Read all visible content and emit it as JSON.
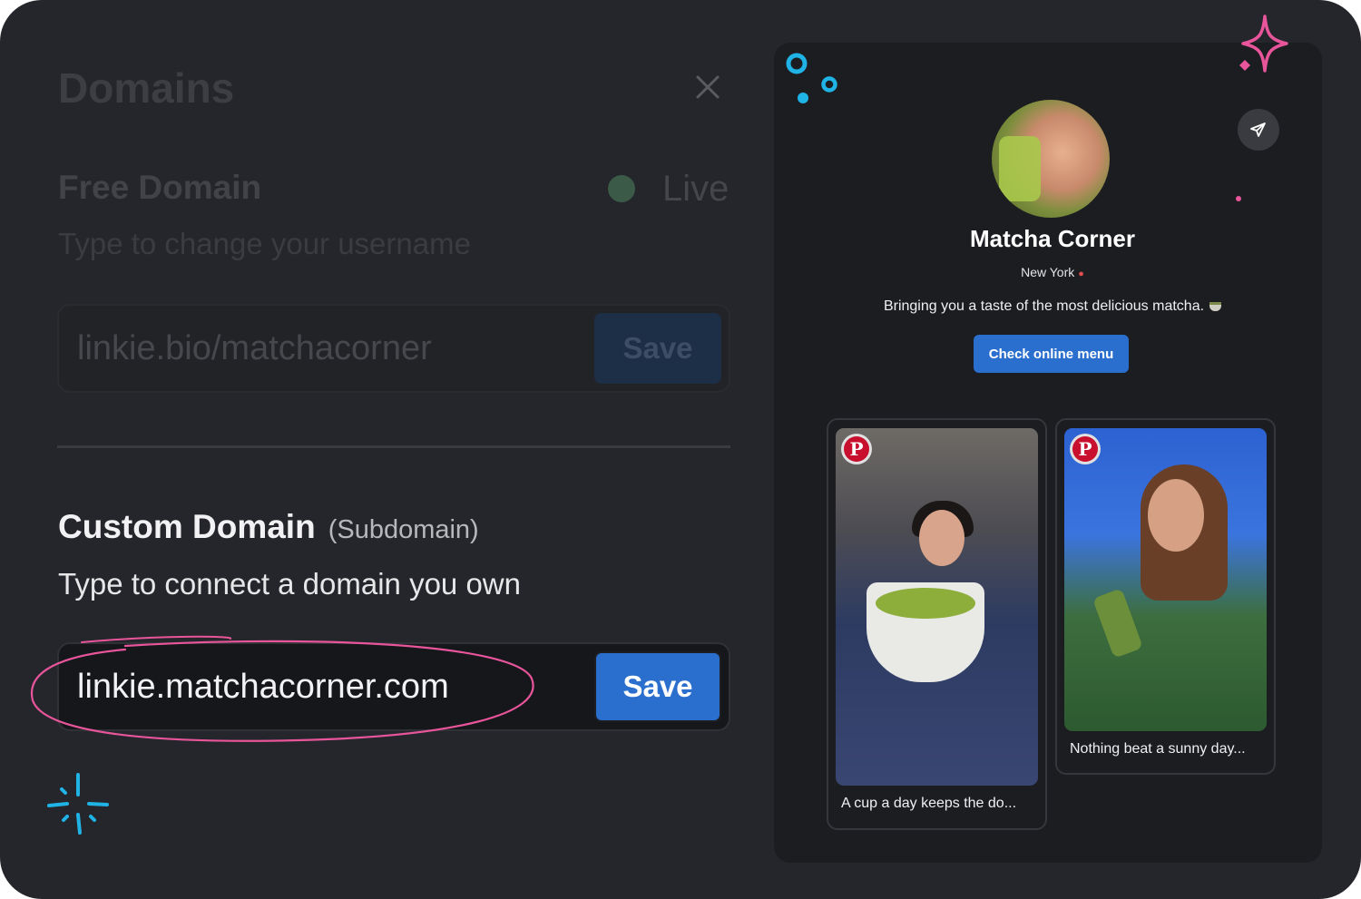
{
  "colors": {
    "background": "#25262b",
    "accent_blue": "#2a6fce",
    "scribble_pink": "#e8559b",
    "deco_cyan": "#1fb3e6",
    "live_green": "#3b5a47"
  },
  "dialog": {
    "title": "Domains",
    "close_icon": "close-icon"
  },
  "free_domain": {
    "title": "Free Domain",
    "status": "Live",
    "subtitle": "Type to change your username",
    "value": "linkie.bio/matchacorner",
    "save_label": "Save"
  },
  "custom_domain": {
    "title": "Custom Domain",
    "qualifier": "(Subdomain)",
    "subtitle": "Type to connect a domain you own",
    "value": "linkie.matchacorner.com",
    "save_label": "Save"
  },
  "profile": {
    "name": "Matcha Corner",
    "location": "New York",
    "location_icon": "pin-icon",
    "bio": "Bringing you a taste of the most delicious matcha.",
    "bio_icon": "matcha-cup-icon",
    "cta_label": "Check online menu",
    "share_icon": "send-icon"
  },
  "cards": [
    {
      "source_icon": "pinterest-icon",
      "caption": "A cup a day keeps the do..."
    },
    {
      "source_icon": "pinterest-icon",
      "caption": "Nothing beat a sunny day..."
    }
  ]
}
